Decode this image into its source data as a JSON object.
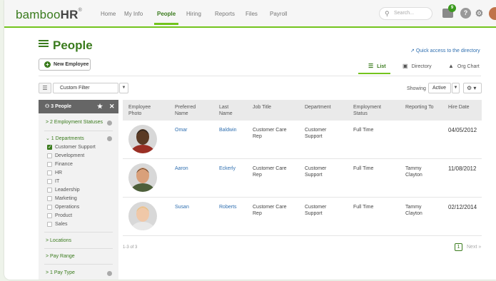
{
  "nav": {
    "logo_part1": "bamboo",
    "logo_part2": "HR",
    "logo_reg": "®",
    "items": [
      "Home",
      "My Info",
      "People",
      "Hiring",
      "Reports",
      "Files",
      "Payroll"
    ],
    "active_item": "People",
    "search_placeholder": "Search...",
    "inbox_badge": "9",
    "icons": [
      "search-icon",
      "inbox-icon",
      "help-icon",
      "gear-icon",
      "avatar"
    ]
  },
  "page": {
    "title": "People",
    "quick_access": "Quick access to the directory",
    "new_employee": "New Employee",
    "views": [
      "List",
      "Directory",
      "Org Chart"
    ],
    "active_view": "List"
  },
  "filter": {
    "label": "Custom Filter",
    "showing_label": "Showing",
    "showing_value": "Active"
  },
  "sidebar": {
    "header": "3 People",
    "employment_statuses": "> 2 Employment Statuses",
    "departments": "⌄ 1 Departments",
    "department_list": [
      {
        "label": "Customer Support",
        "checked": true
      },
      {
        "label": "Development",
        "checked": false
      },
      {
        "label": "Finance",
        "checked": false
      },
      {
        "label": "HR",
        "checked": false
      },
      {
        "label": "IT",
        "checked": false
      },
      {
        "label": "Leadership",
        "checked": false
      },
      {
        "label": "Marketing",
        "checked": false
      },
      {
        "label": "Operations",
        "checked": false
      },
      {
        "label": "Product",
        "checked": false
      },
      {
        "label": "Sales",
        "checked": false
      }
    ],
    "locations": "> Locations",
    "pay_range": "> Pay Range",
    "pay_type": "> 1 Pay Type"
  },
  "table": {
    "headers": {
      "photo": [
        "Employee",
        "Photo"
      ],
      "preferred": [
        "Preferred",
        "Name"
      ],
      "last": [
        "Last",
        "Name"
      ],
      "job": "Job Title",
      "dept": "Department",
      "status": [
        "Employment",
        "Status"
      ],
      "reporting": "Reporting To",
      "hire": "Hire Date"
    },
    "rows": [
      {
        "preferred": "Omar",
        "last": "Baldwin",
        "job": [
          "Customer Care",
          "Rep"
        ],
        "dept": [
          "Customer",
          "Support"
        ],
        "status": "Full Time",
        "reporting": [
          "",
          ""
        ],
        "hire": "04/05/2012",
        "skin": "#5a3a24",
        "hair": "#1a1a1a",
        "shirt": "#9a2f24"
      },
      {
        "preferred": "Aaron",
        "last": "Eckerly",
        "job": [
          "Customer Care",
          "Rep"
        ],
        "dept": [
          "Customer",
          "Support"
        ],
        "status": "Full Time",
        "reporting": [
          "Tammy",
          "Clayton"
        ],
        "hire": "11/08/2012",
        "skin": "#d9a07a",
        "hair": "#5a3a22",
        "shirt": "#4d5f3a"
      },
      {
        "preferred": "Susan",
        "last": "Roberts",
        "job": [
          "Customer Care",
          "Rep"
        ],
        "dept": [
          "Customer",
          "Support"
        ],
        "status": "Full Time",
        "reporting": [
          "Tammy",
          "Clayton"
        ],
        "hire": "02/12/2014",
        "skin": "#f0c8a8",
        "hair": "#e0c07a",
        "shirt": "#e8e8e8"
      }
    ],
    "count_text": "1-3 of 3",
    "page": "1",
    "next": "Next »"
  }
}
